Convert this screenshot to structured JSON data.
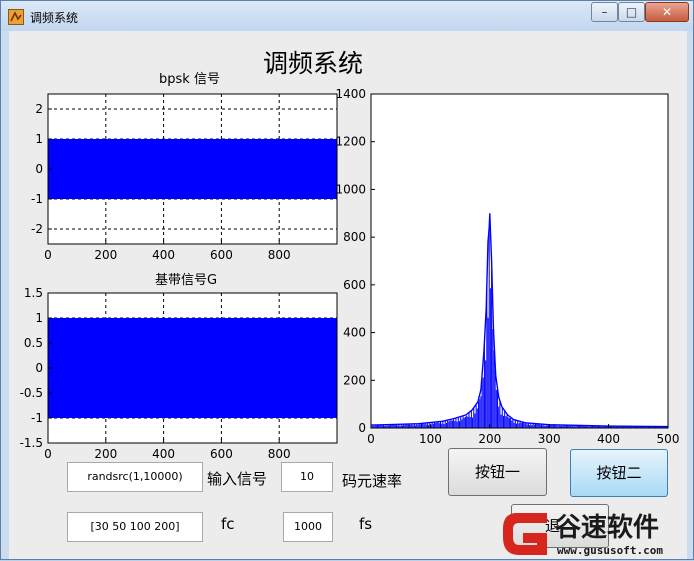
{
  "window": {
    "title": "调频系统",
    "controls": {
      "minimize": "–",
      "maximize": "□",
      "close": "✕"
    }
  },
  "figure": {
    "title": "调频系统"
  },
  "inputs": {
    "signal_value": "randsrc(1,10000)",
    "signal_label": "输入信号",
    "rate_value": "10",
    "rate_label": "码元速率",
    "fc_value": "[30 50 100 200]",
    "fc_label": "fc",
    "fs_value": "1000",
    "fs_label": "fs"
  },
  "buttons": {
    "button1": "按钮一",
    "button2": "按钮二",
    "button3_partial": "退"
  },
  "watermark": {
    "name": "谷速软件",
    "url": "www.gususoft.com"
  },
  "colors": {
    "signal": "#0000ff",
    "grid": "#000000",
    "accent_button": "#a9daf6"
  },
  "chart_data": [
    {
      "type": "line",
      "title": "bpsk 信号",
      "xlim": [
        0,
        1000
      ],
      "ylim": [
        -2.5,
        2.5
      ],
      "xticks": [
        0,
        200,
        400,
        600,
        800
      ],
      "yticks": [
        2,
        1,
        0,
        -1,
        -2
      ],
      "ytick_labels": [
        "2",
        "1",
        "0",
        "-1",
        "-2"
      ],
      "grid": true,
      "series": [
        {
          "fill_band": [
            -1,
            1
          ],
          "x_range": [
            0,
            1000
          ]
        }
      ]
    },
    {
      "type": "line",
      "title": "基带信号G",
      "xlim": [
        0,
        1000
      ],
      "ylim": [
        -1.5,
        1.5
      ],
      "xticks": [
        0,
        200,
        400,
        600,
        800
      ],
      "yticks": [
        1.5,
        1,
        0.5,
        0,
        -0.5,
        -1,
        -1.5
      ],
      "ytick_labels": [
        "1.5",
        "1",
        "0.5",
        "0",
        "-0.5",
        "-1",
        "-1.5"
      ],
      "grid": true,
      "series": [
        {
          "fill_band": [
            -1,
            1
          ],
          "x_range": [
            0,
            1000
          ]
        }
      ]
    },
    {
      "type": "line",
      "title": "",
      "xlim": [
        0,
        500
      ],
      "ylim": [
        0,
        1400
      ],
      "xticks": [
        0,
        100,
        200,
        300,
        400,
        500
      ],
      "yticks": [
        1400,
        1200,
        1000,
        800,
        600,
        400,
        200,
        0
      ],
      "grid": false,
      "series": [
        {
          "x": [
            0,
            40,
            80,
            120,
            140,
            160,
            170,
            180,
            185,
            190,
            194,
            197,
            199,
            200,
            201,
            203,
            206,
            210,
            215,
            220,
            230,
            240,
            260,
            300,
            400,
            500
          ],
          "y": [
            12,
            15,
            18,
            28,
            40,
            55,
            75,
            110,
            160,
            320,
            500,
            780,
            840,
            900,
            830,
            700,
            420,
            220,
            130,
            90,
            55,
            35,
            22,
            14,
            8,
            6
          ]
        }
      ]
    }
  ]
}
